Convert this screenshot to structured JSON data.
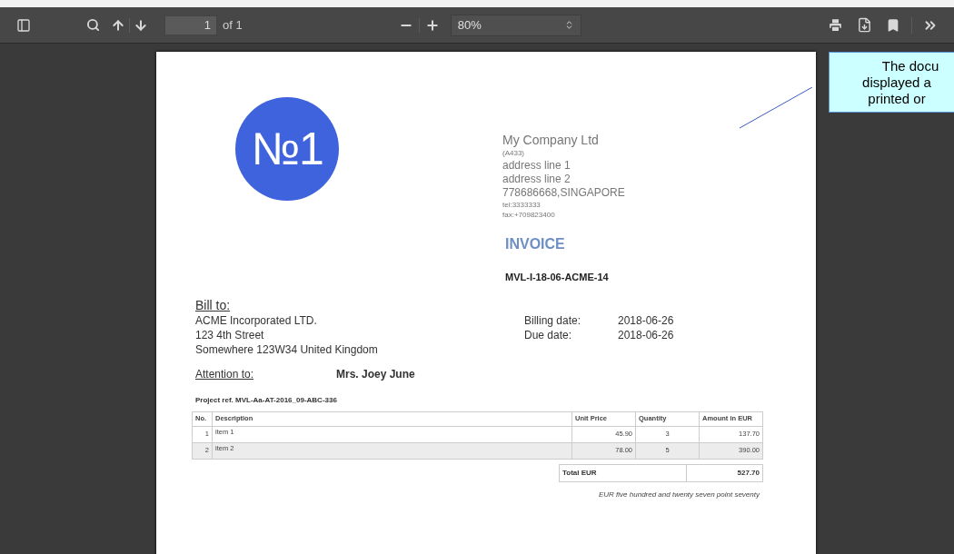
{
  "toolbar": {
    "page_number": "1",
    "page_count": "of 1",
    "zoom": "80%"
  },
  "document": {
    "logo": "№1",
    "company": {
      "name": "My Company Ltd",
      "code": "(A433)",
      "address_lines": [
        "address line 1",
        "address line 2",
        "778686668,SINGAPORE"
      ],
      "contact_lines": [
        "tel:3333333",
        "fax:+709823400"
      ]
    },
    "title": "INVOICE",
    "invoice_number": "MVL-I-18-06-ACME-14",
    "bill_to": {
      "heading": "Bill to:",
      "lines": [
        "ACME Incorporated LTD.",
        "123 4th Street",
        "Somewhere 123W34 United Kingdom"
      ]
    },
    "dates": [
      {
        "label": "Billing date:",
        "value": "2018-06-26"
      },
      {
        "label": "Due date:",
        "value": "2018-06-26"
      }
    ],
    "attention": {
      "label": "Attention to:",
      "value": "Mrs. Joey June"
    },
    "project_ref": "Project ref. MVL-Aa-AT-2016_09-ABC-336",
    "table": {
      "columns": [
        "No.",
        "Description",
        "Unit Price",
        "Quantity",
        "Amount in EUR"
      ],
      "rows": [
        [
          "1",
          "item 1",
          "45.90",
          "3",
          "137.70"
        ],
        [
          "2",
          "item 2",
          "78.00",
          "5",
          "390.00"
        ]
      ]
    },
    "total": {
      "label": "Total EUR",
      "value": "527.70"
    },
    "amount_in_words": "EUR five hundred and twenty seven point seventy"
  },
  "callout": {
    "lines": [
      "The docu",
      "displayed a",
      "printed or"
    ]
  }
}
